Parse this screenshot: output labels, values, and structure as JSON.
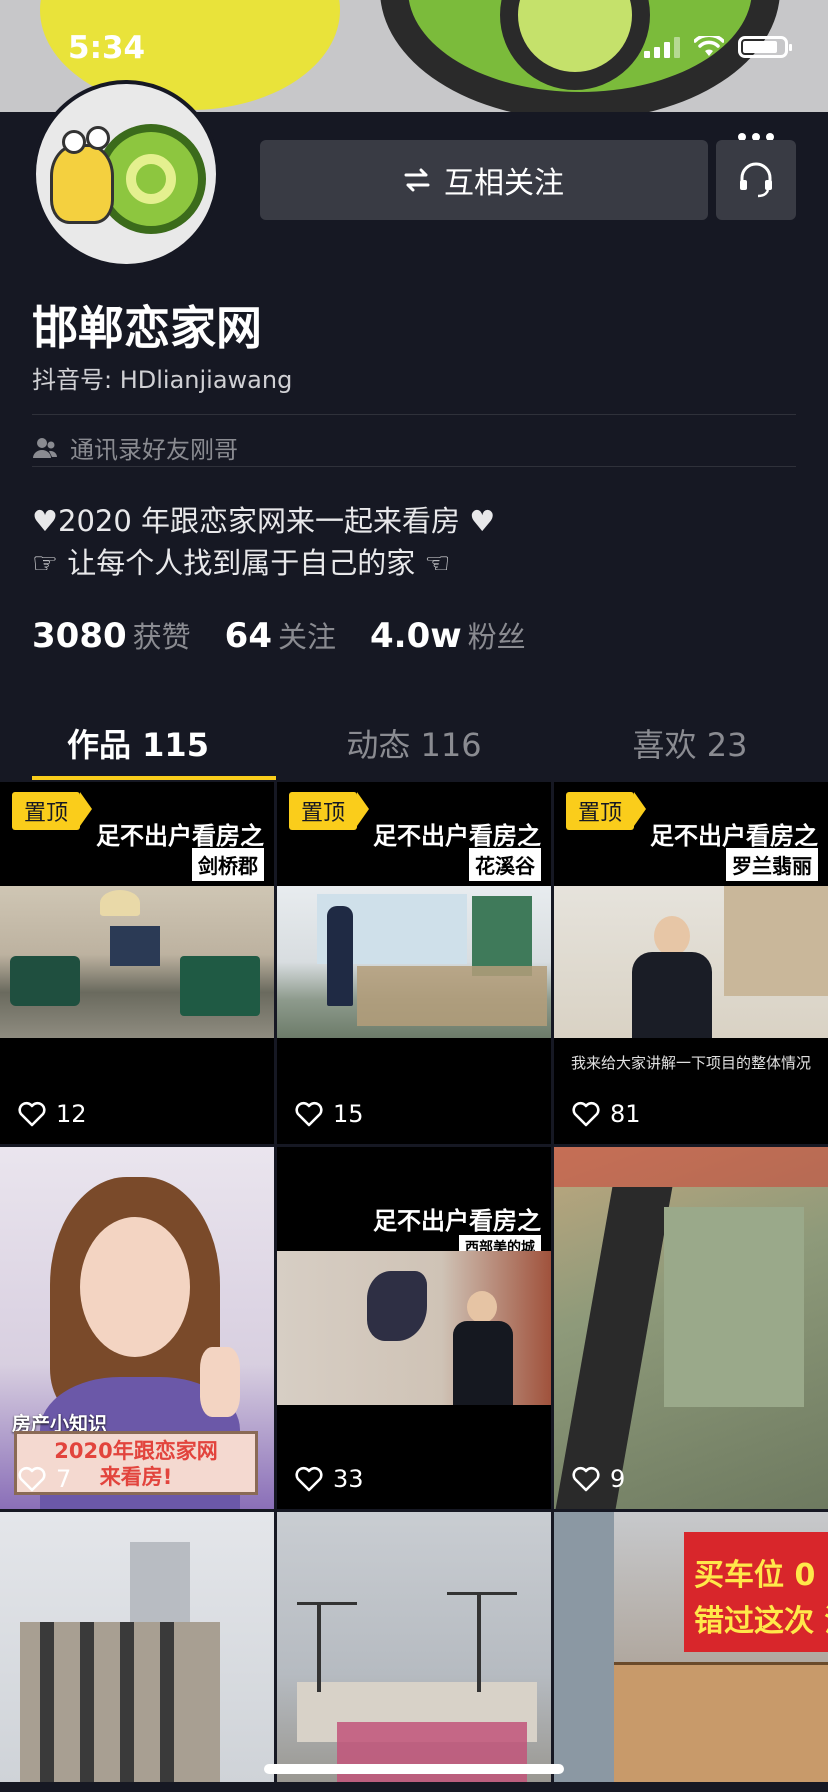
{
  "status_bar": {
    "time": "5:34"
  },
  "profile": {
    "follow_label": "互相关注",
    "name": "邯郸恋家网",
    "uid": "抖音号: HDlianjiawang",
    "contact_hint": "通讯录好友刚哥",
    "bio_line1": "♥2020 年跟恋家网来一起来看房 ♥",
    "bio_line2": "☞ 让每个人找到属于自己的家 ☜"
  },
  "stats": [
    {
      "num": "3080",
      "label": "获赞"
    },
    {
      "num": "64",
      "label": "关注"
    },
    {
      "num": "4.0w",
      "label": "粉丝"
    }
  ],
  "tabs": [
    {
      "label": "作品 115",
      "active": true
    },
    {
      "label": "动态 116",
      "active": false
    },
    {
      "label": "喜欢 23",
      "active": false
    }
  ],
  "videos": [
    {
      "pinned": true,
      "pin_label": "置顶",
      "title": "足不出户看房之",
      "tag": "剑桥郡",
      "likes": "12"
    },
    {
      "pinned": true,
      "pin_label": "置顶",
      "title": "足不出户看房之",
      "tag": "花溪谷",
      "likes": "15"
    },
    {
      "pinned": true,
      "pin_label": "置顶",
      "title": "足不出户看房之",
      "tag": "罗兰翡丽",
      "likes": "81",
      "caption": "我来给大家讲解一下项目的整体情况"
    },
    {
      "overlay_label": "房产小知识",
      "overlay_line1": "2020年跟恋家网",
      "overlay_line2": "来看房!",
      "likes": "7"
    },
    {
      "title": "足不出户看房之",
      "tag": "西部美的城",
      "likes": "33"
    },
    {
      "likes": "9"
    },
    {
      "likes": ""
    },
    {
      "likes": ""
    },
    {
      "banner_text1": "买车位 0",
      "banner_text2": "错过这次 没",
      "likes": ""
    }
  ],
  "colors": {
    "background": "#161823",
    "accent": "#facd1b",
    "button": "#393b44",
    "muted": "#8a8b91"
  }
}
